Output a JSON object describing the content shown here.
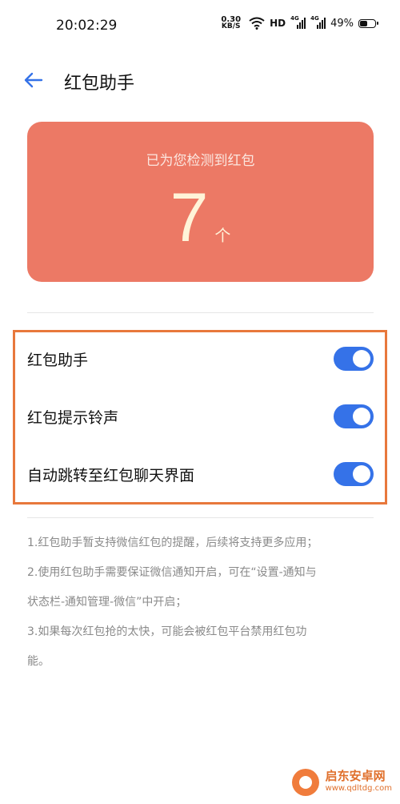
{
  "status_bar": {
    "time": "20:02:29",
    "net_speed_value": "0.30",
    "net_speed_unit": "KB/S",
    "hd_label": "HD",
    "network_1": "4G",
    "network_2": "4G",
    "battery_percent": "49%"
  },
  "header": {
    "title": "红包助手",
    "back_icon": "arrow-left-icon"
  },
  "card": {
    "label": "已为您检测到红包",
    "count": "7",
    "unit": "个",
    "color": "#ec7965"
  },
  "settings": [
    {
      "label": "红包助手",
      "enabled": true
    },
    {
      "label": "红包提示铃声",
      "enabled": true
    },
    {
      "label": "自动跳转至红包聊天界面",
      "enabled": true
    }
  ],
  "accent_color": "#3572e8",
  "highlight_color": "#e8783c",
  "notes": {
    "line1": "1.红包助手暂支持微信红包的提醒，后续将支持更多应用；",
    "line2a": "2.使用红包助手需要保证微信通知开启，可在“设置-通知与",
    "line2b": "状态栏-通知管理-微信”中开启；",
    "line3a": "3.如果每次红包抢的太快，可能会被红包平台禁用红包功",
    "line3b": "能。"
  },
  "watermark": {
    "name": "启东安卓网",
    "url": "www.qdltdg.com"
  }
}
